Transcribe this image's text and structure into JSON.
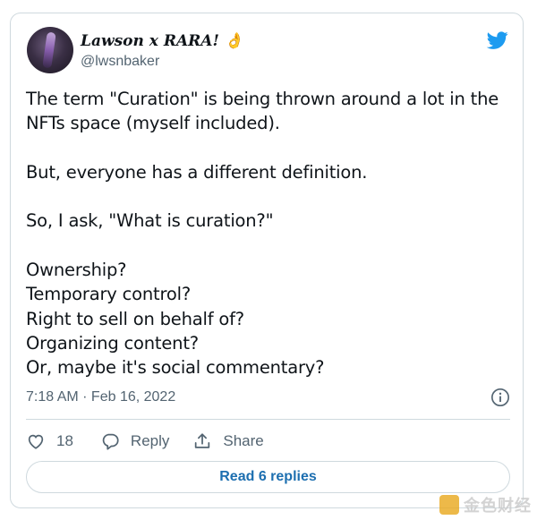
{
  "tweet": {
    "author_name": "Lawson x RARA! 👌",
    "author_handle": "@lwsnbaker",
    "text": "The term \"Curation\" is being thrown around a lot in the NFTs space (myself included).\n\nBut, everyone has a different definition.\n\nSo, I ask, \"What is curation?\"\n\nOwnership?\nTemporary control?\nRight to sell on behalf of?\nOrganizing content?\nOr, maybe it's social commentary?",
    "timestamp": "7:18 AM · Feb 16, 2022"
  },
  "actions": {
    "like_count": "18",
    "reply_label": "Reply",
    "share_label": "Share"
  },
  "read_replies_label": "Read 6 replies",
  "watermark": {
    "text": "金色财经"
  },
  "icons": {
    "brand": "twitter-bird-icon",
    "info": "info-icon",
    "like": "heart-icon",
    "reply": "speech-bubble-icon",
    "share": "share-upload-icon"
  },
  "colors": {
    "twitter_blue": "#1d9bf0",
    "link_blue": "#1d6fb0",
    "text_primary": "#0f1419",
    "text_secondary": "#536471",
    "border": "#cfd9de",
    "watermark_logo": "#e8a81c"
  }
}
